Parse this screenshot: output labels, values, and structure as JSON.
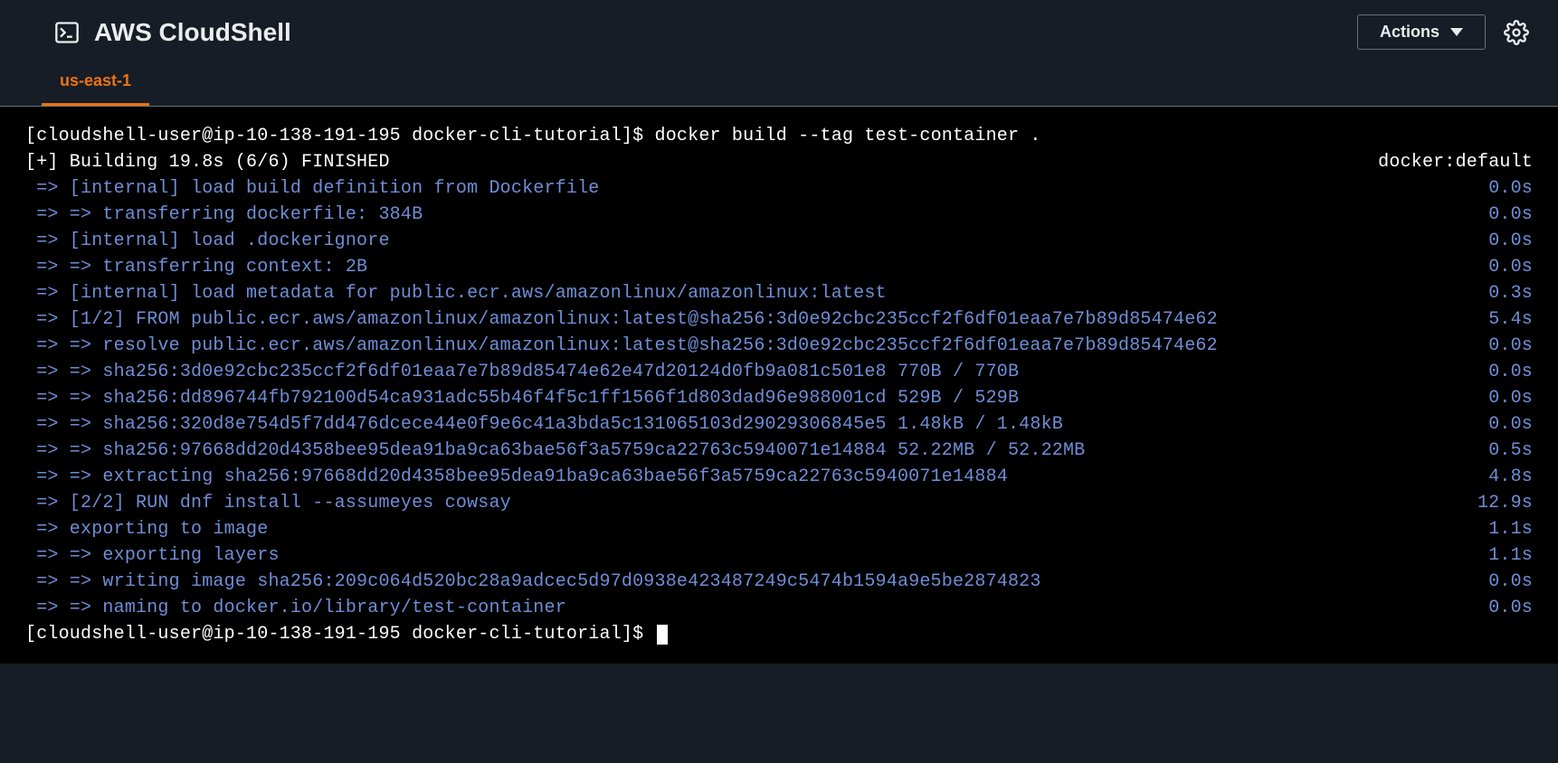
{
  "header": {
    "title": "AWS CloudShell",
    "actions_label": "Actions"
  },
  "tabs": {
    "active": "us-east-1"
  },
  "terminal": {
    "prompt1_left": "[cloudshell-user@ip-10-138-191-195 docker-cli-tutorial]$ ",
    "command1": "docker build --tag test-container .",
    "building_left": "[+] Building 19.8s (6/6) FINISHED",
    "building_right": "docker:default",
    "steps": [
      {
        "left": " => [internal] load build definition from Dockerfile",
        "right": "0.0s"
      },
      {
        "left": " => => transferring dockerfile: 384B",
        "right": "0.0s"
      },
      {
        "left": " => [internal] load .dockerignore",
        "right": "0.0s"
      },
      {
        "left": " => => transferring context: 2B",
        "right": "0.0s"
      },
      {
        "left": " => [internal] load metadata for public.ecr.aws/amazonlinux/amazonlinux:latest",
        "right": "0.3s"
      },
      {
        "left": " => [1/2] FROM public.ecr.aws/amazonlinux/amazonlinux:latest@sha256:3d0e92cbc235ccf2f6df01eaa7e7b89d85474e62",
        "right": "5.4s"
      },
      {
        "left": " => => resolve public.ecr.aws/amazonlinux/amazonlinux:latest@sha256:3d0e92cbc235ccf2f6df01eaa7e7b89d85474e62",
        "right": "0.0s"
      },
      {
        "left": " => => sha256:3d0e92cbc235ccf2f6df01eaa7e7b89d85474e62e47d20124d0fb9a081c501e8 770B / 770B",
        "right": "0.0s"
      },
      {
        "left": " => => sha256:dd896744fb792100d54ca931adc55b46f4f5c1ff1566f1d803dad96e988001cd 529B / 529B",
        "right": "0.0s"
      },
      {
        "left": " => => sha256:320d8e754d5f7dd476dcece44e0f9e6c41a3bda5c131065103d29029306845e5 1.48kB / 1.48kB",
        "right": "0.0s"
      },
      {
        "left": " => => sha256:97668dd20d4358bee95dea91ba9ca63bae56f3a5759ca22763c5940071e14884 52.22MB / 52.22MB",
        "right": "0.5s"
      },
      {
        "left": " => => extracting sha256:97668dd20d4358bee95dea91ba9ca63bae56f3a5759ca22763c5940071e14884",
        "right": "4.8s"
      },
      {
        "left": " => [2/2] RUN dnf install --assumeyes cowsay",
        "right": "12.9s"
      },
      {
        "left": " => exporting to image",
        "right": "1.1s"
      },
      {
        "left": " => => exporting layers",
        "right": "1.1s"
      },
      {
        "left": " => => writing image sha256:209c064d520bc28a9adcec5d97d0938e423487249c5474b1594a9e5be2874823",
        "right": "0.0s"
      },
      {
        "left": " => => naming to docker.io/library/test-container",
        "right": "0.0s"
      }
    ],
    "prompt2_left": "[cloudshell-user@ip-10-138-191-195 docker-cli-tutorial]$ "
  }
}
